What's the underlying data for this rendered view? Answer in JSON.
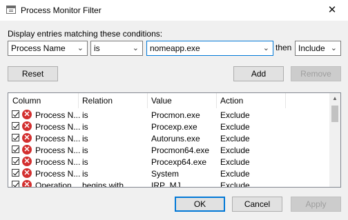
{
  "window": {
    "title": "Process Monitor Filter",
    "close_glyph": "✕"
  },
  "condition": {
    "label": "Display entries matching these conditions:",
    "column_value": "Process Name",
    "relation_value": "is",
    "value_text": "nomeapp.exe",
    "then_label": "then",
    "action_value": "Include"
  },
  "buttons": {
    "reset": "Reset",
    "add": "Add",
    "remove": "Remove",
    "ok": "OK",
    "cancel": "Cancel",
    "apply": "Apply"
  },
  "table": {
    "columns": [
      "Column",
      "Relation",
      "Value",
      "Action"
    ],
    "rows": [
      {
        "column": "Process N...",
        "relation": "is",
        "value": "Procmon.exe",
        "action": "Exclude"
      },
      {
        "column": "Process N...",
        "relation": "is",
        "value": "Procexp.exe",
        "action": "Exclude"
      },
      {
        "column": "Process N...",
        "relation": "is",
        "value": "Autoruns.exe",
        "action": "Exclude"
      },
      {
        "column": "Process N...",
        "relation": "is",
        "value": "Procmon64.exe",
        "action": "Exclude"
      },
      {
        "column": "Process N...",
        "relation": "is",
        "value": "Procexp64.exe",
        "action": "Exclude"
      },
      {
        "column": "Process N...",
        "relation": "is",
        "value": "System",
        "action": "Exclude"
      },
      {
        "column": "Operation",
        "relation": "begins with",
        "value": "IRP_MJ_",
        "action": "Exclude"
      }
    ]
  },
  "colors": {
    "accent": "#0078d7",
    "exclude_icon": "#d32f2f"
  }
}
